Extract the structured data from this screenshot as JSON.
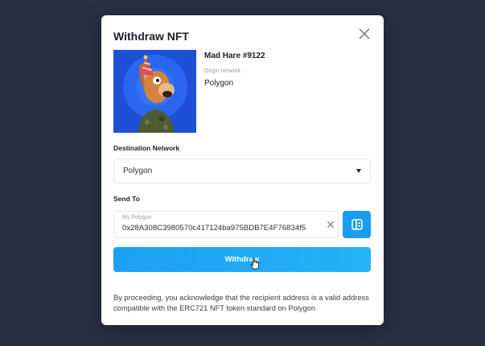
{
  "modal": {
    "title": "Withdraw NFT",
    "close_icon": "close-icon"
  },
  "nft": {
    "name": "Mad Hare #9122",
    "origin_label": "Origin network",
    "origin_value": "Polygon",
    "image_icon": "nft-thumbnail"
  },
  "destination": {
    "label": "Destination Network",
    "selected": "Polygon",
    "caret_icon": "caret-down-icon"
  },
  "send_to": {
    "label": "Send To",
    "field_label": "My Polygon",
    "address": "0x28A308C3980570c417124ba975BDB7E4F76834f5",
    "clear_icon": "clear-icon",
    "address_book_icon": "address-book-icon"
  },
  "actions": {
    "withdraw_label": "Withdraw"
  },
  "disclaimer": "By proceeding, you acknowledge that the recipient address is a valid address compatible with the ERC721 NFT token standard on Polygon",
  "colors": {
    "background": "#283142",
    "accent": "#1a9cf0",
    "text": "#1b1f2a",
    "muted": "#9aa1ad"
  }
}
